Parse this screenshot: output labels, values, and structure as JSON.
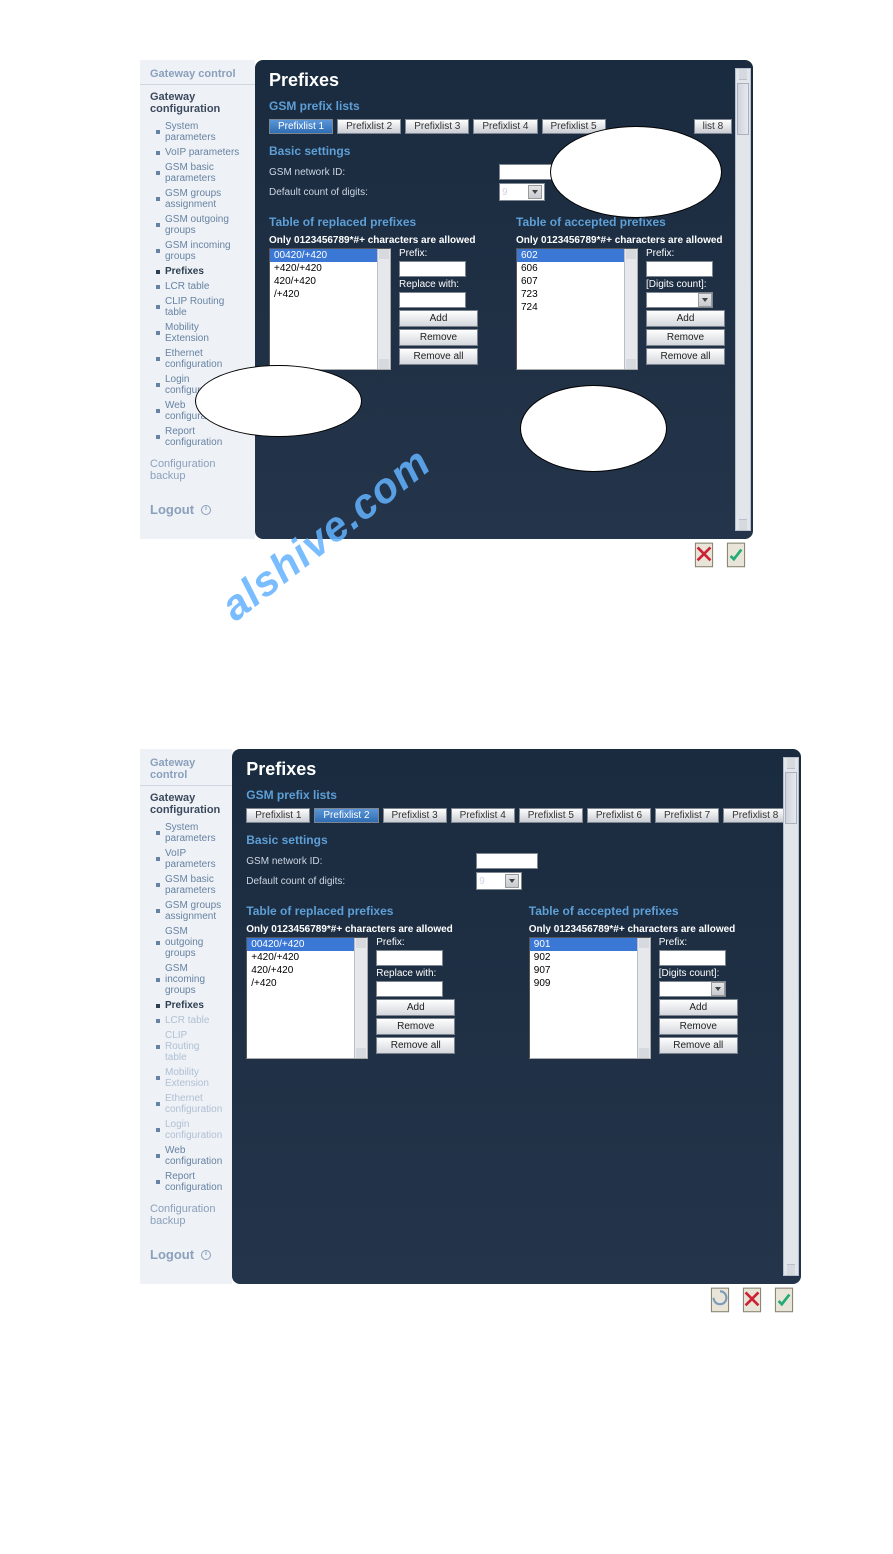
{
  "watermark": "alshive.com",
  "common": {
    "sidebar": {
      "control_header": "Gateway control",
      "config_header": "Gateway configuration",
      "items": [
        "System parameters",
        "VoIP parameters",
        "GSM basic parameters",
        "GSM groups assignment",
        "GSM outgoing groups",
        "GSM incoming groups",
        "Prefixes",
        "LCR table",
        "CLIP Routing table",
        "Mobility Extension",
        "Ethernet configuration",
        "Login configuration",
        "Web configuration",
        "Report configuration"
      ],
      "backup": "Configuration backup",
      "logout": "Logout"
    },
    "main": {
      "title": "Prefixes",
      "section_lists": "GSM prefix lists",
      "section_basic": "Basic settings",
      "lbl_network": "GSM network ID:",
      "lbl_digits": "Default count of digits:",
      "digits_value": "9",
      "section_replaced": "Table of replaced prefixes",
      "section_accepted": "Table of accepted prefixes",
      "allowed_note": "Only 0123456789*#+ characters are allowed",
      "lbl_prefix": "Prefix:",
      "lbl_replace": "Replace with:",
      "lbl_digits_count": "[Digits count]:",
      "btn_add": "Add",
      "btn_remove": "Remove",
      "btn_remove_all": "Remove all"
    }
  },
  "panel1": {
    "tabs": [
      "Prefixlist 1",
      "Prefixlist 2",
      "Prefixlist 3",
      "Prefixlist 4",
      "Prefixlist 5",
      "",
      "",
      "list 8"
    ],
    "active_tab": 0,
    "replaced": [
      "00420/+420",
      "+420/+420",
      "420/+420",
      "/+420"
    ],
    "accepted": [
      "602",
      "606",
      "607",
      "723",
      "724"
    ],
    "sidebar_visible_count": 14
  },
  "panel2": {
    "tabs": [
      "Prefixlist 1",
      "Prefixlist 2",
      "Prefixlist 3",
      "Prefixlist 4",
      "Prefixlist 5",
      "Prefixlist 6",
      "Prefixlist 7",
      "Prefixlist 8"
    ],
    "active_tab": 1,
    "replaced": [
      "00420/+420",
      "+420/+420",
      "420/+420",
      "/+420"
    ],
    "accepted": [
      "901",
      "902",
      "907",
      "909"
    ]
  }
}
